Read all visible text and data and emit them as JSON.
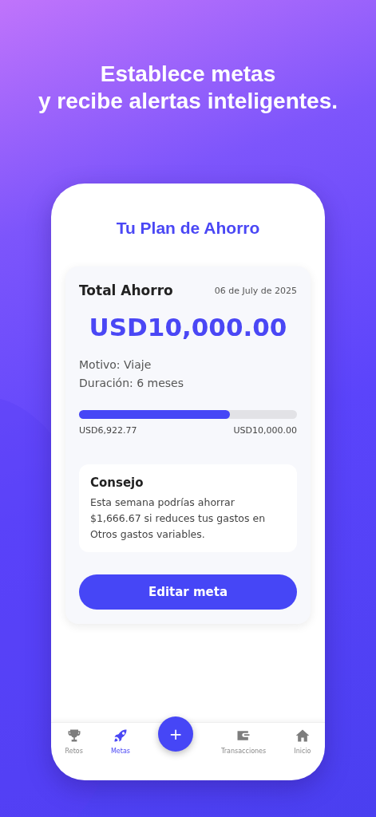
{
  "headline": [
    "Establece metas",
    "y recibe alertas inteligentes."
  ],
  "screen_title": "Tu Plan de Ahorro",
  "card": {
    "title": "Total Ahorro",
    "date": "06 de July de 2025",
    "amount": "USD10,000.00",
    "details": [
      "Motivo: Viaje",
      "Duración: 6 meses"
    ],
    "progress": {
      "level": 0.692,
      "current": "USD6,922.77",
      "target": "USD10,000.00"
    },
    "tip": {
      "title": "Consejo",
      "text": "Esta semana podrías ahorrar $1,666.67 si reduces tus gastos en Otros gastos variables."
    },
    "button": "Editar meta"
  },
  "fab": "+",
  "nav": [
    {
      "kind": "trophy",
      "label": "Retos",
      "selected": false
    },
    {
      "kind": "rocket",
      "label": "Metas",
      "selected": true
    },
    {
      "kind": "wallet",
      "label": "Transacciones",
      "selected": false
    },
    {
      "kind": "home",
      "label": "Inicio",
      "selected": false
    }
  ]
}
